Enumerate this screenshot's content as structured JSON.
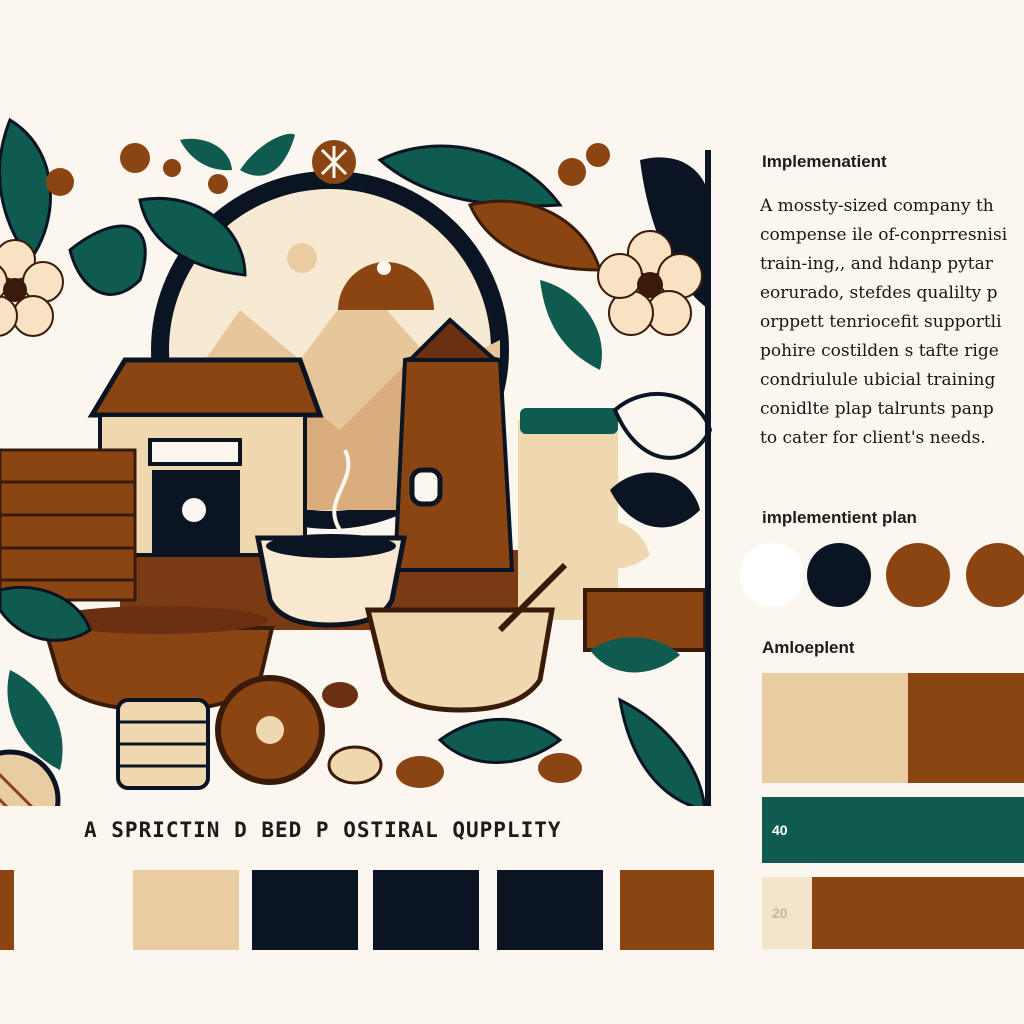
{
  "illustration": {
    "caption": "A SPRICTIN D BED P OSTIRAL QUPPLITY"
  },
  "colors": {
    "cream": "#fbf7ef",
    "beige": "#e9cca2",
    "tan": "#d9b48a",
    "brown": "#8b4513",
    "dark_brown": "#6b2f12",
    "navy": "#0b1423",
    "teal": "#0f5b50",
    "white": "#ffffff"
  },
  "swatch_row": [
    {
      "color": "#8b4513"
    },
    {
      "color": "#e9cca2"
    },
    {
      "color": "#0b1423"
    },
    {
      "color": "#0b1423"
    },
    {
      "color": "#0b1423"
    },
    {
      "color": "#8b4513"
    }
  ],
  "implementation": {
    "heading": "Implemenatient",
    "lines": [
      "A mossty-sized company th",
      "compense ile of-conprresnisi",
      "train-ing,, and hdanp pytar",
      "eorurado, stefdes qualilty p",
      "orppett tenriocefit supportli",
      "pohire costilden s tafte rige",
      "condriulule ubicial training",
      "conidlte plap talrunts panp",
      "to cater for client's needs."
    ]
  },
  "plan": {
    "heading": "implementient plan",
    "circles": [
      {
        "name": "white-circle",
        "color": "#ffffff"
      },
      {
        "name": "navy-circle",
        "color": "#0b1423"
      },
      {
        "name": "brown-circle",
        "color": "#8b4513"
      },
      {
        "name": "brown-circle-2",
        "color": "#8b4513"
      }
    ]
  },
  "amloplent": {
    "heading": "Amloeplent",
    "bars": [
      {
        "label": "",
        "left_color": "#e9cca2",
        "right_color": "#8b4513"
      },
      {
        "label": "40",
        "left_color": "#0f5b50",
        "right_color": "#0f5b50"
      },
      {
        "label": "20",
        "left_color": "#f4e4cc",
        "right_color": "#8b4513"
      }
    ]
  }
}
